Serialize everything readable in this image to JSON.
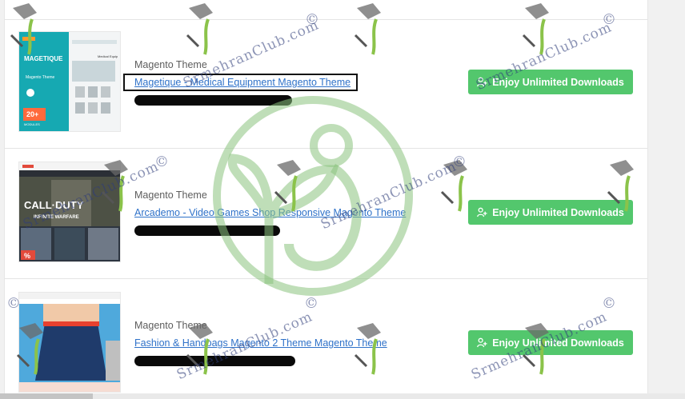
{
  "items": [
    {
      "type": "Magento Theme",
      "title": "Magetique - Medical Equipment Magento Theme",
      "button": "Enjoy Unlimited Downloads",
      "thumb": {
        "brand": "MAGETIQUE",
        "subtitle": "Magento Theme",
        "badge": "20+",
        "badge_label": "MODULES",
        "inner_label": "Medical Equip"
      }
    },
    {
      "type": "Magento Theme",
      "title": "Arcademo - Video Games Shop Responsive Magento Theme",
      "button": "Enjoy Unlimited Downloads",
      "thumb": {
        "line1": "CALL·DUTY",
        "line2": "INFINITE WARFARE",
        "badge": "%"
      }
    },
    {
      "type": "Magento Theme",
      "title": "Fashion & Handbags Magento 2 Theme Magento Theme",
      "button": "Enjoy Unlimited Downloads",
      "thumb": {}
    }
  ],
  "watermark": {
    "text": "SrmehranClub.com",
    "symbol": "©"
  },
  "colors": {
    "button": "#53c76d",
    "link": "#2f72c9",
    "accent": "#17a7b4",
    "logo": "#8bc37d"
  }
}
